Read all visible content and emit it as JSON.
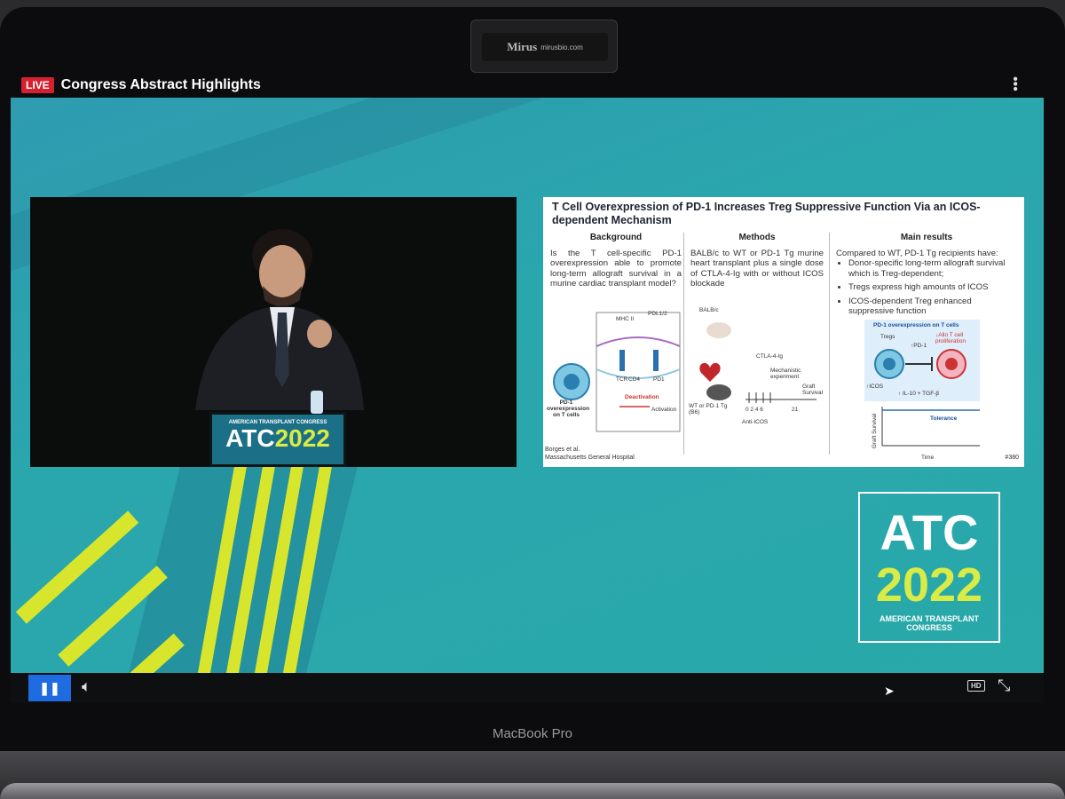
{
  "camera_cover": {
    "brand": "Mirus",
    "url": "mirusbio.com"
  },
  "player": {
    "live_badge": "LIVE",
    "stream_title": "Congress Abstract Highlights",
    "menu_icon": "kebab-menu-icon",
    "pause_icon": "pause-icon",
    "volume_icon": "speaker-icon",
    "hd_label": "HD",
    "fullscreen_icon": "collapse-icon"
  },
  "podium": {
    "line1": "AMERICAN TRANSPLANT CONGRESS",
    "line2a": "ATC",
    "line2b": "2022"
  },
  "slide": {
    "title": "T Cell Overexpression of PD-1 Increases Treg Suppressive Function Via an ICOS-dependent Mechanism",
    "background": {
      "heading": "Background",
      "text": "Is the T cell-specific PD-1 overexpression able to promote long-term allograft survival in a murine cardiac transplant model?",
      "labels": {
        "mhc": "MHC II",
        "pdl": "PDL1/2",
        "tcr": "TCR",
        "cd4": "CD4",
        "pd1": "PD1",
        "deact": "Deactivation",
        "act": "Activation",
        "cap": "PD-1 overexpression on T cells"
      }
    },
    "methods": {
      "heading": "Methods",
      "text": "BALB/c to WT or PD-1 Tg murine heart transplant plus a single dose of CTLA-4-Ig with or without ICOS blockade",
      "labels": {
        "donor": "BALB/c",
        "ctla": "CTLA-4-Ig",
        "mech": "Mechanistic experiment",
        "recip": "WT or PD-1 Tg (B6)",
        "days": "0 2 4 6",
        "d21": "21",
        "anti": "Anti-ICOS",
        "graft": "Graft Survival"
      }
    },
    "results": {
      "heading": "Main results",
      "intro": "Compared to WT, PD-1 Tg recipients have:",
      "bullets": [
        "Donor-specific long-term allograft survival which is Treg-dependent;",
        "Tregs express high amounts of ICOS",
        "ICOS-dependent Treg enhanced suppressive function"
      ],
      "figure": {
        "title": "PD-1 overexpression on T cells",
        "tregs": "Tregs",
        "pd1": "↑PD-1",
        "icos": "↑ICOS",
        "prolif": "↓Allo T cell proliferation",
        "il10": "↑ IL-10 + TGF-β",
        "y": "Graft Survival",
        "x": "Time",
        "tol": "Tolerance"
      }
    },
    "footer": {
      "authors": "Borges et al.",
      "affil": "Massachusetts General Hospital",
      "num": "#380"
    }
  },
  "logo": {
    "line1": "ATC",
    "line2": "2022",
    "line3": "AMERICAN TRANSPLANT CONGRESS"
  },
  "laptop": {
    "label": "MacBook Pro"
  },
  "colors": {
    "stage": "#2aa6ad",
    "accent_yellow": "#d7e62c",
    "live_red": "#d3212f",
    "pause_blue": "#1f6be0"
  }
}
